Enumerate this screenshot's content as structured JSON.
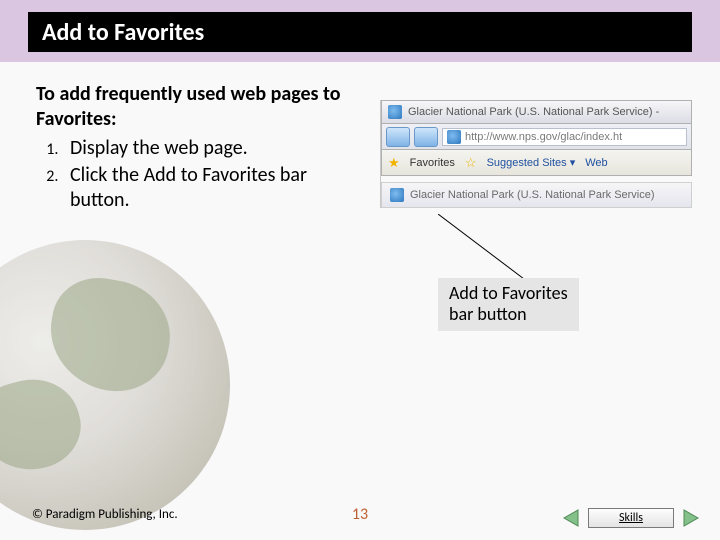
{
  "title": "Add to Favorites",
  "intro": "To add frequently used web pages to Favorites:",
  "steps": {
    "s1": "Display the web page.",
    "s2": "Click the Add to Favorites bar button."
  },
  "browser": {
    "windowTitle": "Glacier National Park (U.S. National Park Service) -",
    "url": "http://www.nps.gov/glac/index.ht",
    "favLabel": "Favorites",
    "suggested": "Suggested Sites ▾",
    "webSlice": "Web",
    "tabTitle": "Glacier National Park (U.S. National Park Service)"
  },
  "callout": {
    "line1": "Add to Favorites",
    "line2": "bar button"
  },
  "footer": {
    "copyright": "© Paradigm Publishing, Inc.",
    "page": "13",
    "skills": "Skills"
  }
}
